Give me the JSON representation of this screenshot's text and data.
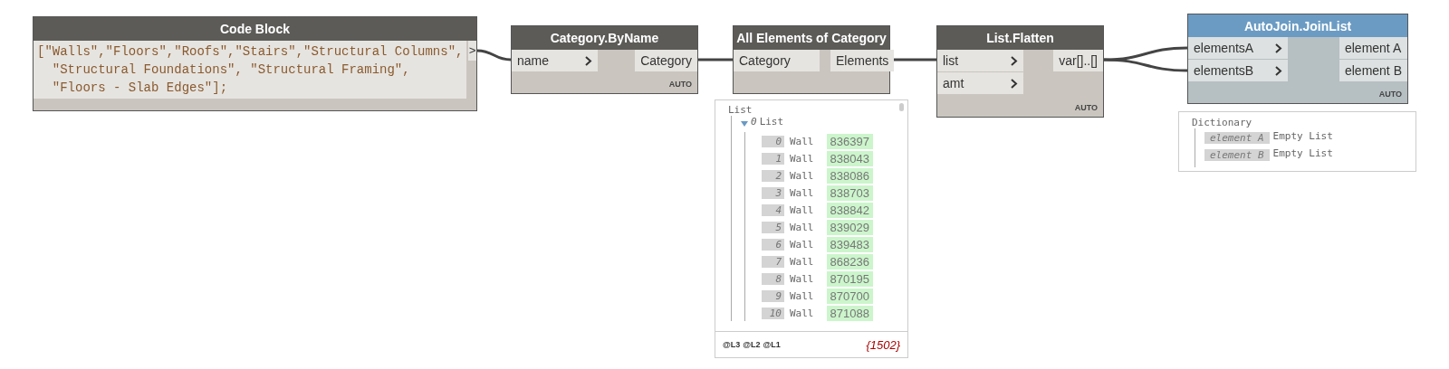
{
  "nodes": [
    {
      "kind": "code",
      "title": "Code Block",
      "selected": false,
      "code": [
        "[\"Walls\",\"Floors\",\"Roofs\",\"Stairs\",\"Structural Columns\",",
        "  \"Structural Foundations\", \"Structural Framing\",",
        "  \"Floors - Slab Edges\"];"
      ],
      "outputs": [
        {
          "label": ">"
        }
      ]
    },
    {
      "kind": "function",
      "title": "Category.ByName",
      "selected": false,
      "inputs": [
        {
          "label": "name"
        }
      ],
      "outputs": [
        {
          "label": "Category"
        }
      ],
      "lacing": "AUTO"
    },
    {
      "kind": "function",
      "title": "All Elements of Category",
      "selected": false,
      "inputs": [
        {
          "label": "Category",
          "arrow": false
        }
      ],
      "outputs": [
        {
          "label": "Elements"
        }
      ]
    },
    {
      "kind": "function",
      "title": "List.Flatten",
      "selected": false,
      "inputs": [
        {
          "label": "list"
        },
        {
          "label": "amt"
        }
      ],
      "outputs": [
        {
          "label": "var[]..[]"
        }
      ],
      "lacing": "AUTO"
    },
    {
      "kind": "function",
      "title": "AutoJoin.JoinList",
      "selected": true,
      "inputs": [
        {
          "label": "elementsA"
        },
        {
          "label": "elementsB"
        }
      ],
      "outputs": [
        {
          "label": "element A"
        },
        {
          "label": "element B"
        }
      ],
      "lacing": "AUTO"
    }
  ],
  "list_preview": {
    "title": "List",
    "sublist": {
      "index": "0",
      "title": "List",
      "expanded": true,
      "items": [
        {
          "index": "0",
          "type": "Wall",
          "id": "836397"
        },
        {
          "index": "1",
          "type": "Wall",
          "id": "838043"
        },
        {
          "index": "2",
          "type": "Wall",
          "id": "838086"
        },
        {
          "index": "3",
          "type": "Wall",
          "id": "838703"
        },
        {
          "index": "4",
          "type": "Wall",
          "id": "838842"
        },
        {
          "index": "5",
          "type": "Wall",
          "id": "839029"
        },
        {
          "index": "6",
          "type": "Wall",
          "id": "839483"
        },
        {
          "index": "7",
          "type": "Wall",
          "id": "868236"
        },
        {
          "index": "8",
          "type": "Wall",
          "id": "870195"
        },
        {
          "index": "9",
          "type": "Wall",
          "id": "870700"
        },
        {
          "index": "10",
          "type": "Wall",
          "id": "871088"
        }
      ]
    },
    "levels": [
      "@L3",
      "@L2",
      "@L1"
    ],
    "count": "{1502}"
  },
  "dictionary_preview": {
    "title": "Dictionary",
    "entries": [
      {
        "key": "element A",
        "value": "Empty List"
      },
      {
        "key": "element B",
        "value": "Empty List"
      }
    ]
  }
}
